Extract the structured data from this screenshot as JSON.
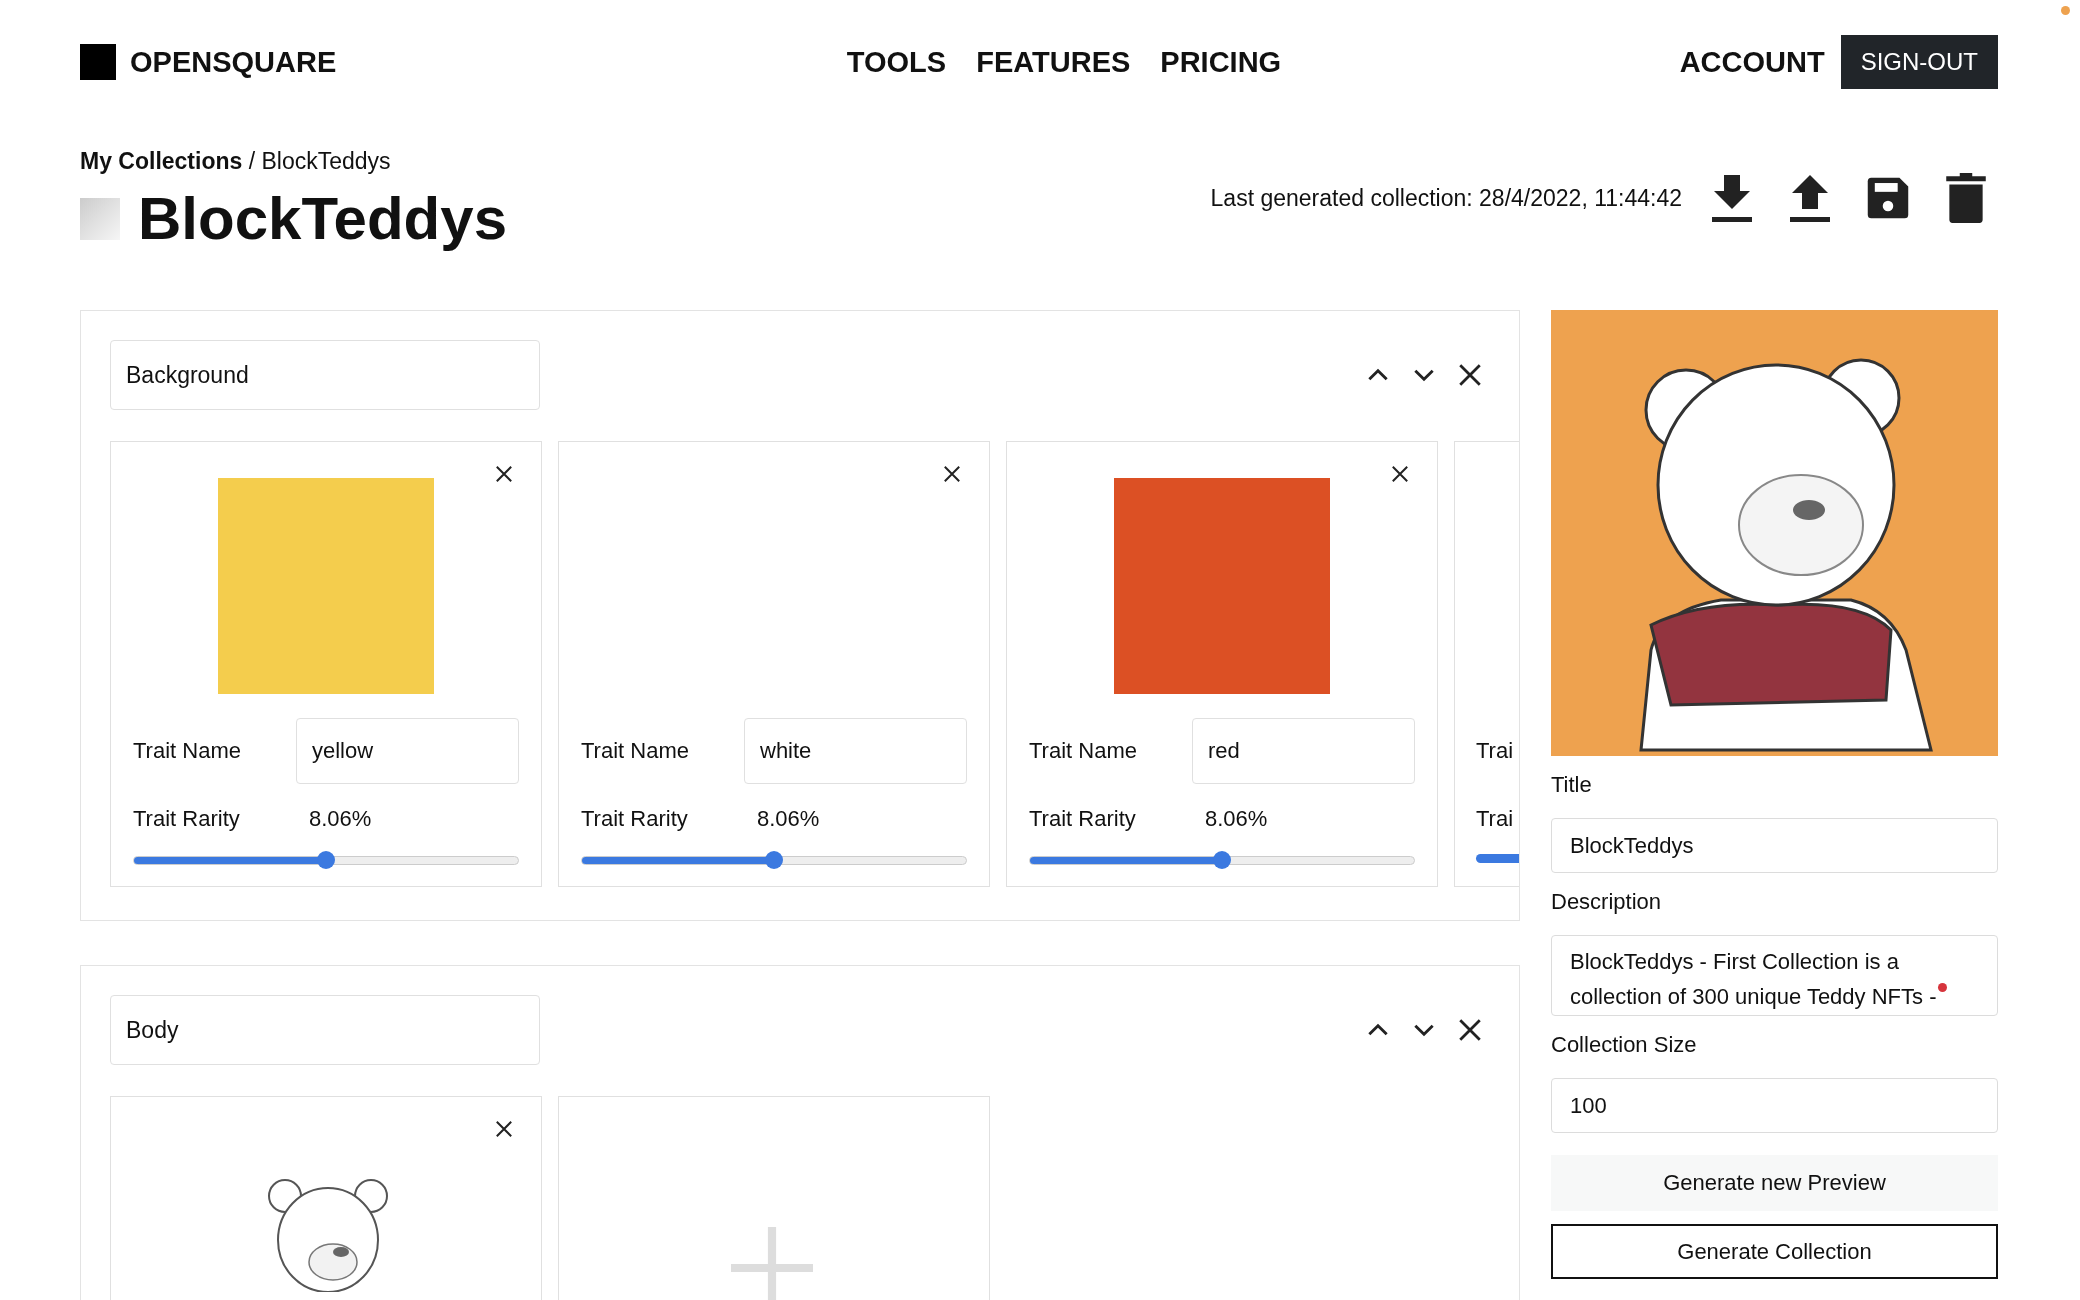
{
  "header": {
    "logo": "OPENSQUARE",
    "nav": [
      {
        "label": "TOOLS"
      },
      {
        "label": "FEATURES"
      },
      {
        "label": "PRICING"
      }
    ],
    "account": "ACCOUNT",
    "sign_out": "SIGN-OUT"
  },
  "breadcrumb": "**My Collections** / BlockTeddys",
  "title": "BlockTeddys",
  "last_generated": "Last generated collection: 28/4/2022, 11:44:42",
  "layers": [
    {
      "name": "Background",
      "traits": [
        {
          "kind": "color",
          "color": "#f4cd4d",
          "name_label": "Trait Name",
          "name": "yellow",
          "rarity_label": "Trait Rarity",
          "rarity": "8.06%",
          "level": 0.5
        },
        {
          "kind": "blank",
          "name_label": "Trait Name",
          "name": "white",
          "rarity_label": "Trait Rarity",
          "rarity": "8.06%",
          "level": 0.5
        },
        {
          "kind": "color",
          "color": "#dc5024",
          "name_label": "Trait Name",
          "name": "red",
          "rarity_label": "Trait Rarity",
          "rarity": "8.06%",
          "level": 0.5
        },
        {
          "kind": "partial",
          "name_label": "Trai",
          "rarity_label": "Trai"
        }
      ]
    },
    {
      "name": "Body",
      "traits": [
        {
          "kind": "picture"
        },
        {
          "kind": "add"
        }
      ]
    }
  ],
  "sidebar": {
    "title_label": "Title",
    "title": "BlockTeddys",
    "description_label": "Description",
    "description": "BlockTeddys - First Collection is a collection of 300 unique Teddy NFTs -",
    "size_label": "Collection Size",
    "size": "100",
    "preview_button": "Generate new Preview",
    "generate_button": "Generate Collection"
  }
}
